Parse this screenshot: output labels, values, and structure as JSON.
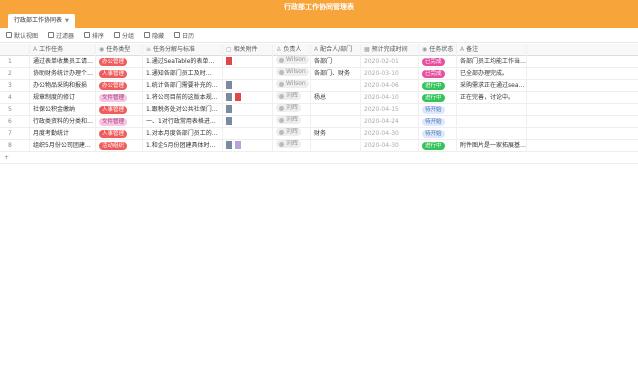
{
  "window": {
    "title": "行政部工作协同管理表"
  },
  "tab": {
    "label": "行政部工作协同表"
  },
  "toolbar": [
    "默认视图",
    "过滤器",
    "排序",
    "分组",
    "隐藏",
    "日历"
  ],
  "columns": [
    "工作任务",
    "任务类型",
    "任务分解与标准",
    "相关附件",
    "负责人",
    "配合人/部门",
    "预计完成时间",
    "任务状态",
    "备注"
  ],
  "rows": [
    {
      "n": "1",
      "task": "通过表单收集员工请工…",
      "type": "办公管理",
      "standard": "1.通过SeaTable的表单…",
      "attach": [
        "pdf"
      ],
      "owner": "Wilson",
      "partner": "各部门",
      "date": "2020-02-01",
      "status": "已完成",
      "note": "各部门员工均能工作当…"
    },
    {
      "n": "2",
      "task": "协助财务统计办理个人…",
      "type": "人事管理",
      "standard": "1.通知各部门员工及时…",
      "attach": [],
      "owner": "Wilson",
      "partner": "各部门、财务",
      "date": "2020-03-10",
      "status": "已完成",
      "note": "已全部办理完成。"
    },
    {
      "n": "3",
      "task": "办公物品采购和报损",
      "type": "办公管理",
      "standard": "1.统计各部门需要补充的…",
      "attach": [
        "doc"
      ],
      "owner": "Wilson",
      "partner": "",
      "date": "2020-04-06",
      "status": "进行中",
      "note": "采购需求正在通过seat…"
    },
    {
      "n": "4",
      "task": "规章制度的修订",
      "type": "文件管理",
      "standard": "1.将公司目前的这版本规…",
      "attach": [
        "doc",
        "pdf"
      ],
      "owner": "刘辉",
      "partner": "杨总",
      "date": "2020-04-10",
      "status": "进行中",
      "note": "正在完善，讨论中。"
    },
    {
      "n": "5",
      "task": "社保公积金缴纳",
      "type": "人事管理",
      "standard": "1.跟税务处对公共社保门…",
      "attach": [
        "doc"
      ],
      "owner": "刘辉",
      "partner": "",
      "date": "2020-04-15",
      "status": "待开始",
      "note": ""
    },
    {
      "n": "6",
      "task": "行政类资料的分类和保存",
      "type": "文件管理",
      "standard": "一、1对行政常用表格进…",
      "attach": [
        "doc"
      ],
      "owner": "刘辉",
      "partner": "",
      "date": "2020-04-24",
      "status": "待开始",
      "note": ""
    },
    {
      "n": "7",
      "task": "月度考勤统计",
      "type": "人事管理",
      "standard": "1.对本月度各部门员工的…",
      "attach": [],
      "owner": "刘辉",
      "partner": "财务",
      "date": "2020-04-30",
      "status": "待开始",
      "note": ""
    },
    {
      "n": "8",
      "task": "组织5月份公司团建团…",
      "type": "活动组织",
      "standard": "1.和企5月份团建具体时…",
      "attach": [
        "doc",
        "img"
      ],
      "owner": "刘辉",
      "partner": "",
      "date": "2020-04-30",
      "status": "进行中",
      "note": "附件图片是一家拓展基…"
    }
  ],
  "colors": {
    "brand": "#f7a43b",
    "done": "#e84ea0",
    "doing": "#35c45a",
    "todo": "#dce8fb",
    "type_red": "#f05b5b",
    "type_pink": "#f6c6e2"
  },
  "add_row": "+"
}
